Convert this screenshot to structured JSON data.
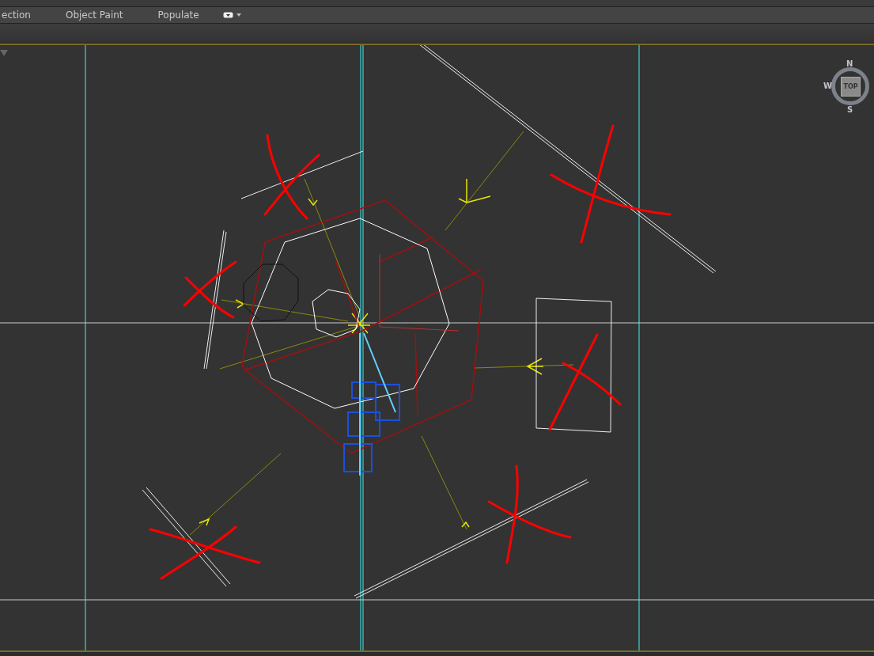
{
  "ribbon_tabs": [
    {
      "label": "ection"
    },
    {
      "label": "Object Paint"
    },
    {
      "label": "Populate"
    }
  ],
  "viewcube": {
    "north": "N",
    "west": "W",
    "south": "S",
    "face": "TOP"
  }
}
